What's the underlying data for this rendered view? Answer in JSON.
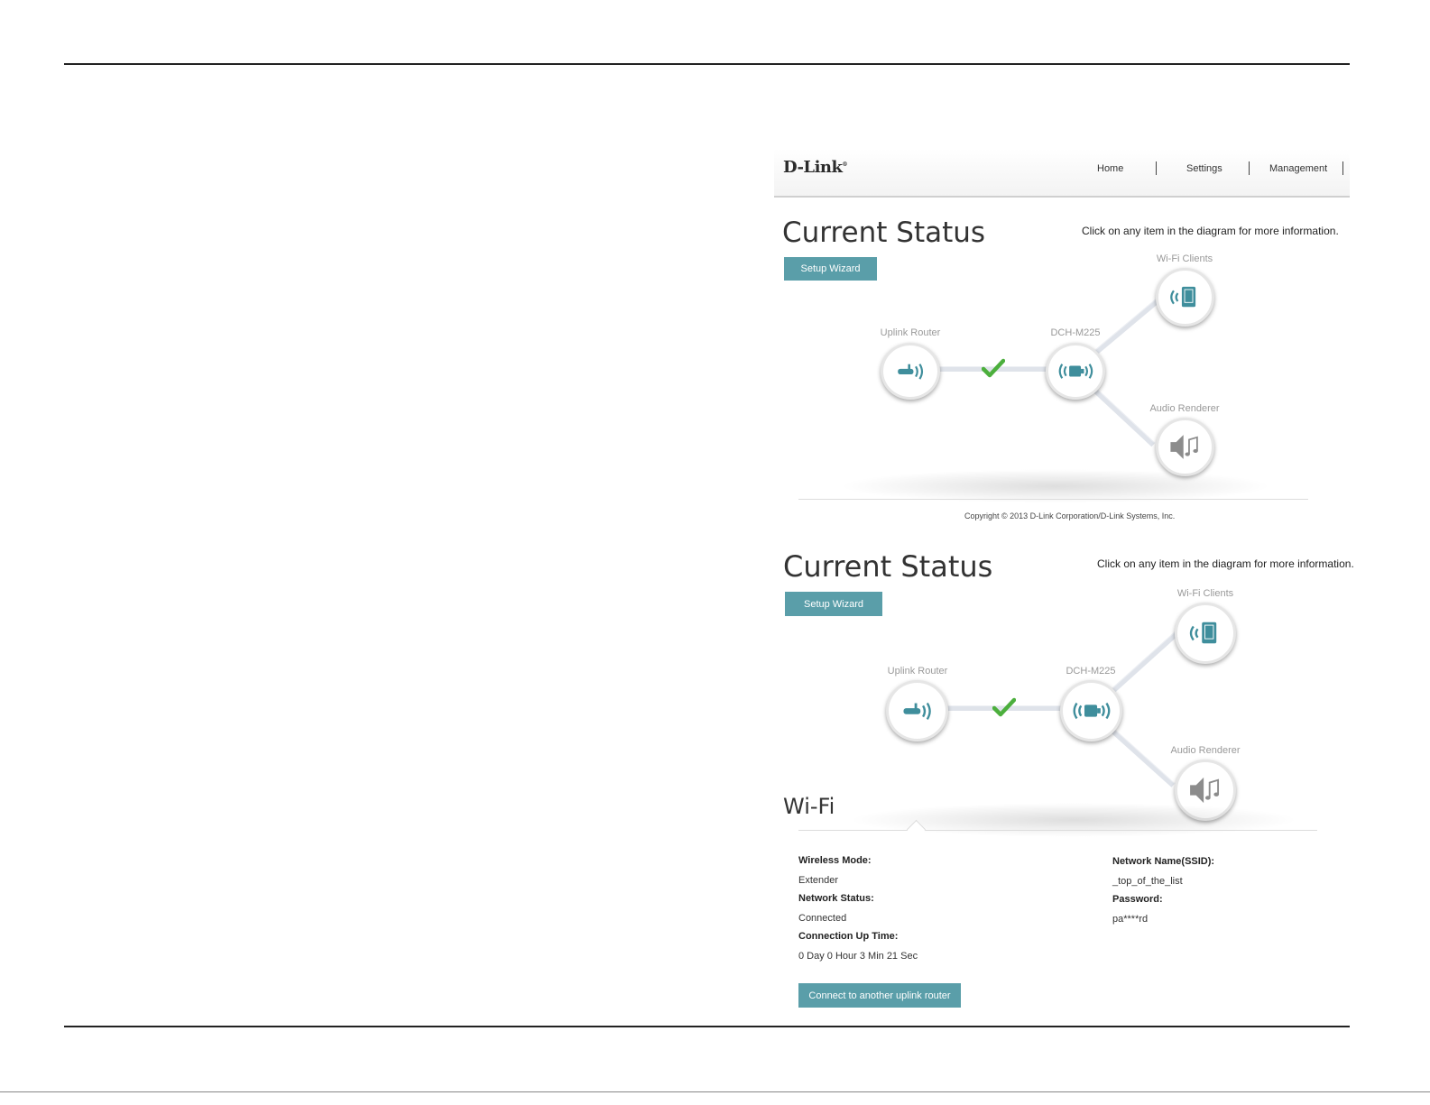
{
  "header": {
    "logo": "D-Link",
    "nav": [
      "Home",
      "Settings",
      "Management"
    ]
  },
  "panels": [
    {
      "title": "Current Status",
      "hint": "Click on any item in the diagram for more information.",
      "setup_wizard": "Setup Wizard",
      "nodes": {
        "uplink_router": "Uplink Router",
        "device": "DCH-M225",
        "wifi_clients": "Wi-Fi Clients",
        "audio_renderer": "Audio Renderer"
      },
      "copyright": "Copyright © 2013 D-Link Corporation/D-Link Systems, Inc."
    },
    {
      "title": "Current Status",
      "hint": "Click on any item in the diagram for more information.",
      "setup_wizard": "Setup Wizard",
      "nodes": {
        "uplink_router": "Uplink Router",
        "device": "DCH-M225",
        "wifi_clients": "Wi-Fi Clients",
        "audio_renderer": "Audio Renderer"
      }
    }
  ],
  "wifi": {
    "title": "Wi-Fi",
    "wireless_mode_label": "Wireless Mode:",
    "wireless_mode": "Extender",
    "network_status_label": "Network Status:",
    "network_status": "Connected",
    "uptime_label": "Connection Up Time:",
    "uptime": "0 Day 0 Hour 3 Min 21 Sec",
    "ssid_label": "Network Name(SSID):",
    "ssid": "_top_of_the_list",
    "password_label": "Password:",
    "password": "pa****rd",
    "connect_button": "Connect to another uplink router"
  },
  "colors": {
    "accent": "#5a9ea9",
    "icon": "#3f8e9c",
    "check": "#4caf3d"
  },
  "icons": [
    "router-icon",
    "extender-icon",
    "wifi-client-icon",
    "speaker-icon",
    "check-icon"
  ]
}
